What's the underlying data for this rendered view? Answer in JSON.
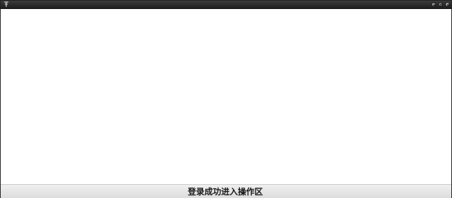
{
  "window": {
    "controls": [
      {
        "name": "minimize-button",
        "icon": "minimize-icon"
      },
      {
        "name": "maximize-button",
        "icon": "maximize-icon"
      },
      {
        "name": "close-button",
        "icon": "close-icon"
      }
    ]
  },
  "statusbar": {
    "message": "登录成功进入操作区"
  }
}
